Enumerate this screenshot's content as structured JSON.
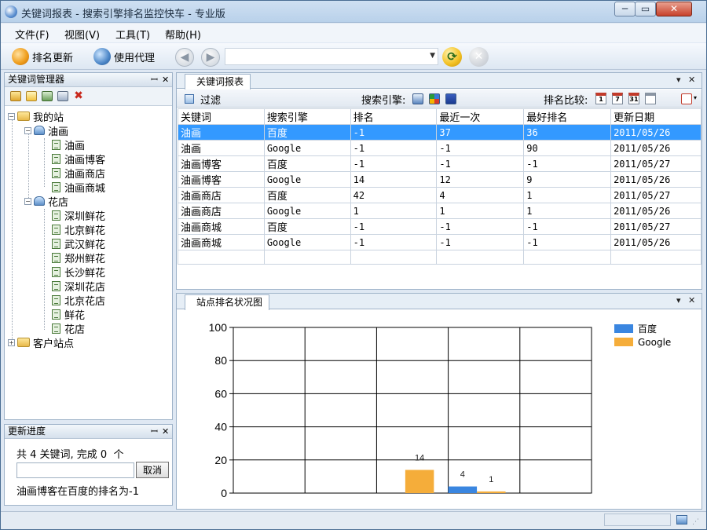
{
  "window": {
    "title": "关键词报表 - 搜索引擎排名监控快车 - 专业版",
    "minimize": "─",
    "maximize": "▭",
    "close": "✕"
  },
  "menu": [
    "文件(F)",
    "视图(V)",
    "工具(T)",
    "帮助(H)"
  ],
  "toolbar": {
    "refresh_label": "排名更新",
    "proxy_label": "使用代理",
    "address_value": ""
  },
  "kw_manager": {
    "title": "关键词管理器",
    "pin": "ꟷ",
    "close": "✕",
    "tree": {
      "root": "我的站",
      "sites": [
        {
          "name": "油画",
          "keywords": [
            "油画",
            "油画博客",
            "油画商店",
            "油画商城"
          ]
        },
        {
          "name": "花店",
          "keywords": [
            "深圳鲜花",
            "北京鲜花",
            "武汉鲜花",
            "郑州鲜花",
            "长沙鲜花",
            "深圳花店",
            "北京花店",
            "鲜花",
            "花店"
          ]
        }
      ],
      "client_sites": "客户站点"
    }
  },
  "progress": {
    "title": "更新进度",
    "summary": "共 4 关键词, 完成 0  个",
    "input_value": "",
    "cancel_label": "取消",
    "message": "油画博客在百度的排名为-1"
  },
  "report": {
    "tab_label": "关键词报表",
    "filter_label": "过滤",
    "engine_label": "搜索引擎:",
    "compare_label": "排名比较:",
    "columns": [
      "关键词",
      "搜索引擎",
      "排名",
      "最近一次",
      "最好排名",
      "更新日期"
    ],
    "rows": [
      [
        "油画",
        "百度",
        "-1",
        "37",
        "36",
        "2011/05/26"
      ],
      [
        "油画",
        "Google",
        "-1",
        "-1",
        "90",
        "2011/05/26"
      ],
      [
        "油画博客",
        "百度",
        "-1",
        "-1",
        "-1",
        "2011/05/27"
      ],
      [
        "油画博客",
        "Google",
        "14",
        "12",
        "9",
        "2011/05/26"
      ],
      [
        "油画商店",
        "百度",
        "42",
        "4",
        "1",
        "2011/05/27"
      ],
      [
        "油画商店",
        "Google",
        "1",
        "1",
        "1",
        "2011/05/26"
      ],
      [
        "油画商城",
        "百度",
        "-1",
        "-1",
        "-1",
        "2011/05/27"
      ],
      [
        "油画商城",
        "Google",
        "-1",
        "-1",
        "-1",
        "2011/05/26"
      ]
    ],
    "selected_row": 0
  },
  "chart": {
    "tab_label": "站点排名状况图"
  },
  "chart_data": {
    "type": "bar",
    "ylim": [
      0,
      100
    ],
    "yticks": [
      0,
      20,
      40,
      60,
      80,
      100
    ],
    "categories": [
      "",
      "",
      "",
      "",
      ""
    ],
    "series": [
      {
        "name": "百度",
        "color": "#3a86e0",
        "values": [
          null,
          null,
          null,
          4,
          null
        ]
      },
      {
        "name": "Google",
        "color": "#f5ad3a",
        "values": [
          null,
          null,
          14,
          1,
          null
        ]
      }
    ],
    "data_labels": [
      {
        "series": 1,
        "index": 2,
        "text": "14"
      },
      {
        "series": 0,
        "index": 3,
        "text": "4"
      },
      {
        "series": 1,
        "index": 3,
        "text": "1"
      }
    ],
    "grid": true,
    "legend_position": "top-right"
  },
  "colors": {
    "selection": "#3399ff",
    "baidu": "#3a86e0",
    "google": "#f5ad3a"
  }
}
